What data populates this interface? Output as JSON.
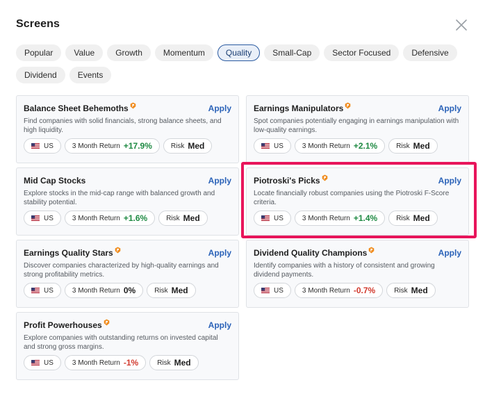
{
  "header": {
    "title": "Screens",
    "close_icon": "close-icon"
  },
  "filters": [
    {
      "label": "Popular",
      "active": false
    },
    {
      "label": "Value",
      "active": false
    },
    {
      "label": "Growth",
      "active": false
    },
    {
      "label": "Momentum",
      "active": false
    },
    {
      "label": "Quality",
      "active": true
    },
    {
      "label": "Small-Cap",
      "active": false
    },
    {
      "label": "Sector Focused",
      "active": false
    },
    {
      "label": "Defensive",
      "active": false
    },
    {
      "label": "Dividend",
      "active": false
    },
    {
      "label": "Events",
      "active": false
    }
  ],
  "cards": [
    {
      "title": "Balance Sheet Behemoths",
      "pro": true,
      "apply": "Apply",
      "description": "Find companies with solid financials, strong balance sheets, and high liquidity.",
      "region": "US",
      "return_label": "3 Month Return",
      "return_value": "+17.9%",
      "return_trend": "pos",
      "risk_label": "Risk",
      "risk_value": "Med"
    },
    {
      "title": "Earnings Manipulators",
      "pro": true,
      "apply": "Apply",
      "description": "Spot companies potentially engaging in earnings manipulation with low-quality earnings.",
      "region": "US",
      "return_label": "3 Month Return",
      "return_value": "+2.1%",
      "return_trend": "pos",
      "risk_label": "Risk",
      "risk_value": "Med"
    },
    {
      "title": "Mid Cap Stocks",
      "pro": false,
      "apply": "Apply",
      "description": "Explore stocks in the mid-cap range with balanced growth and stability potential.",
      "region": "US",
      "return_label": "3 Month Return",
      "return_value": "+1.6%",
      "return_trend": "pos",
      "risk_label": "Risk",
      "risk_value": "Med"
    },
    {
      "title": "Piotroski's Picks",
      "pro": true,
      "apply": "Apply",
      "description": "Locate financially robust companies using the Piotroski F-Score criteria.",
      "region": "US",
      "return_label": "3 Month Return",
      "return_value": "+1.4%",
      "return_trend": "pos",
      "risk_label": "Risk",
      "risk_value": "Med"
    },
    {
      "title": "Earnings Quality Stars",
      "pro": true,
      "apply": "Apply",
      "description": "Discover companies characterized by high-quality earnings and strong profitability metrics.",
      "region": "US",
      "return_label": "3 Month Return",
      "return_value": "0%",
      "return_trend": "neu",
      "risk_label": "Risk",
      "risk_value": "Med"
    },
    {
      "title": "Dividend Quality Champions",
      "pro": true,
      "apply": "Apply",
      "description": "Identify companies with a history of consistent and growing dividend payments.",
      "region": "US",
      "return_label": "3 Month Return",
      "return_value": "-0.7%",
      "return_trend": "neg",
      "risk_label": "Risk",
      "risk_value": "Med"
    },
    {
      "title": "Profit Powerhouses",
      "pro": true,
      "apply": "Apply",
      "description": "Explore companies with outstanding returns on invested capital and strong gross margins.",
      "region": "US",
      "return_label": "3 Month Return",
      "return_value": "-1%",
      "return_trend": "neg",
      "risk_label": "Risk",
      "risk_value": "Med"
    }
  ],
  "colors": {
    "accent": "#2a62b8",
    "highlight": "#e8155b",
    "positive": "#1f8a43",
    "negative": "#d23b2f",
    "pro_badge": "#f08c1e"
  }
}
